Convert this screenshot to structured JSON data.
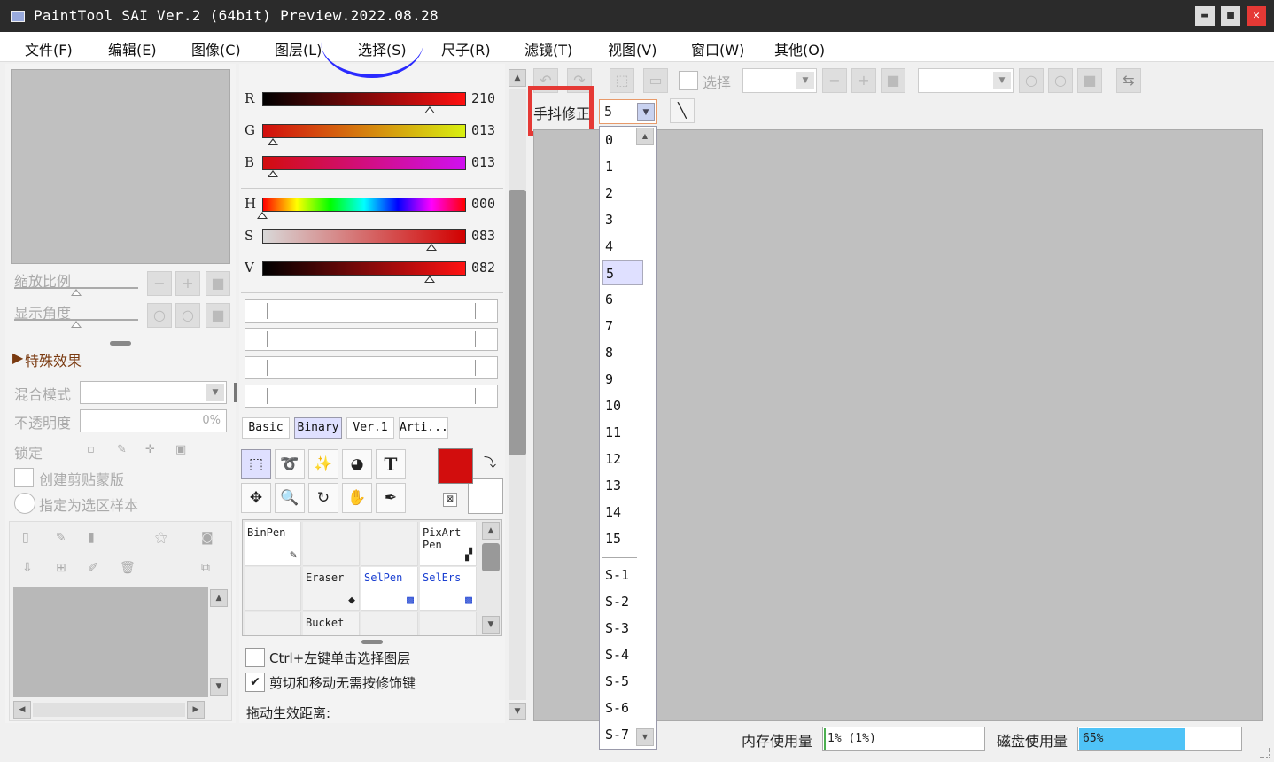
{
  "window": {
    "title": "PaintTool SAI Ver.2 (64bit) Preview.2022.08.28",
    "minimize": "▬",
    "maximize": "■",
    "close": "✕"
  },
  "menu": [
    "文件(F)",
    "编辑(E)",
    "图像(C)",
    "图层(L)",
    "选择(S)",
    "尺子(R)",
    "滤镜(T)",
    "视图(V)",
    "窗口(W)",
    "其他(O)"
  ],
  "navigator": {
    "zoom_label": "缩放比例",
    "angle_label": "显示角度"
  },
  "layer_panel": {
    "effects_label": "特殊效果",
    "blend_label": "混合模式",
    "opacity_label": "不透明度",
    "opacity_value": "0%",
    "lock_label": "锁定",
    "clip_label": "创建剪贴蒙版",
    "sample_label": "指定为选区样本"
  },
  "color": {
    "rgb": [
      {
        "label": "R",
        "value": "210",
        "pos": 0.82
      },
      {
        "label": "G",
        "value": "013",
        "pos": 0.05
      },
      {
        "label": "B",
        "value": "013",
        "pos": 0.05
      }
    ],
    "hsv": [
      {
        "label": "H",
        "value": "000",
        "pos": 0.0
      },
      {
        "label": "S",
        "value": "083",
        "pos": 0.83
      },
      {
        "label": "V",
        "value": "082",
        "pos": 0.82
      }
    ],
    "main_color": "#d20d0d",
    "sub_color": "#ffffff"
  },
  "tool_tabs": [
    "Basic",
    "Binary",
    "Ver.1",
    "Arti..."
  ],
  "active_tab": "Binary",
  "brushes": [
    {
      "name": "BinPen",
      "type": "normal"
    },
    {
      "name": "",
      "type": "empty"
    },
    {
      "name": "",
      "type": "empty"
    },
    {
      "name": "PixArt Pen",
      "type": "normal"
    },
    {
      "name": "",
      "type": "empty"
    },
    {
      "name": "Eraser",
      "type": "normal"
    },
    {
      "name": "SelPen",
      "type": "blue"
    },
    {
      "name": "SelErs",
      "type": "blue"
    },
    {
      "name": "",
      "type": "empty"
    },
    {
      "name": "Bucket",
      "type": "normal"
    },
    {
      "name": "",
      "type": "empty"
    },
    {
      "name": "",
      "type": "empty"
    }
  ],
  "options": {
    "ctrl_click": "Ctrl+左键单击选择图层",
    "no_modifier": "剪切和移动无需按修饰键",
    "drag_distance": "拖动生效距离:"
  },
  "toolbar": {
    "select_label": "选择",
    "stabilizer_label": "手抖修正",
    "stabilizer_value": "5"
  },
  "stabilizer_options": [
    "0",
    "1",
    "2",
    "3",
    "4",
    "5",
    "6",
    "7",
    "8",
    "9",
    "10",
    "11",
    "12",
    "13",
    "14",
    "15",
    "S-1",
    "S-2",
    "S-3",
    "S-4",
    "S-5",
    "S-6",
    "S-7"
  ],
  "status": {
    "memory_label": "内存使用量",
    "memory_value": "1% (1%)",
    "memory_fraction": 0.01,
    "disk_label": "磁盘使用量",
    "disk_value": "65%",
    "disk_fraction": 0.65
  },
  "colors": {
    "highlight": "#e53935",
    "disk_bar": "#4fc3f7",
    "selected_item": "#dfe0ff"
  }
}
